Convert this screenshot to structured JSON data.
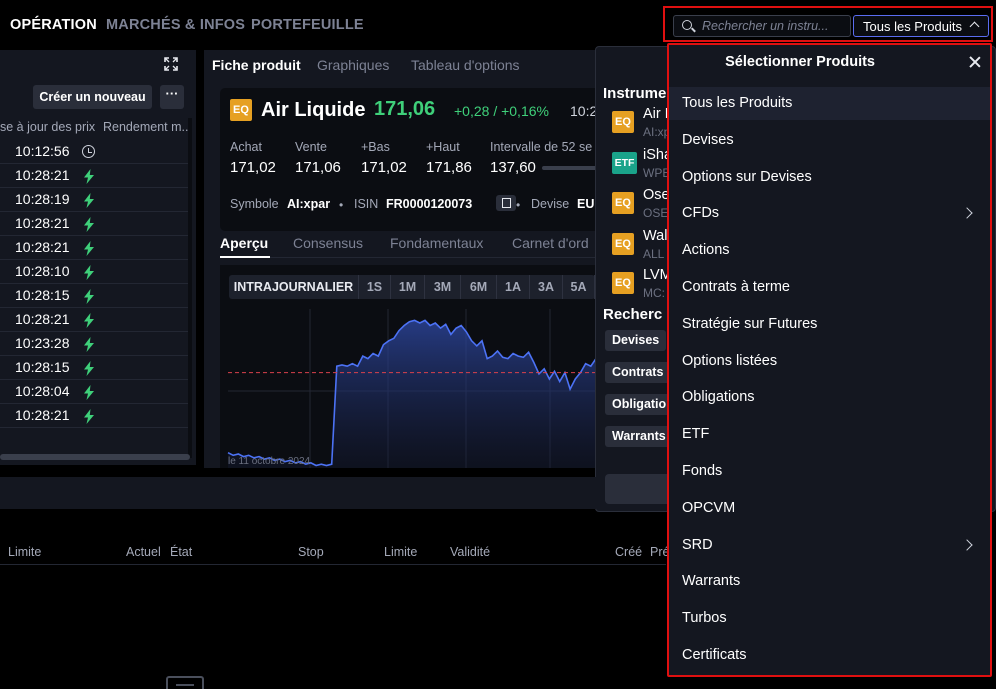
{
  "nav": {
    "items": [
      "OPÉRATION",
      "MARCHÉS & INFOS",
      "PORTEFEUILLE"
    ],
    "active_index": 0
  },
  "search": {
    "placeholder": "Rechercher un instru...",
    "product_filter": "Tous les Produits"
  },
  "left_panel": {
    "create_label": "Créer un nouveau",
    "more_label": "···",
    "col_price_update": "se à jour des prix",
    "col_yield": "Rendement m...",
    "rows": [
      {
        "time": "10:12:56",
        "icon": "clock-icon"
      },
      {
        "time": "10:28:21",
        "icon": "bolt-icon"
      },
      {
        "time": "10:28:19",
        "icon": "bolt-icon"
      },
      {
        "time": "10:28:21",
        "icon": "bolt-icon"
      },
      {
        "time": "10:28:21",
        "icon": "bolt-icon"
      },
      {
        "time": "10:28:10",
        "icon": "bolt-icon"
      },
      {
        "time": "10:28:15",
        "icon": "bolt-icon"
      },
      {
        "time": "10:28:21",
        "icon": "bolt-icon"
      },
      {
        "time": "10:23:28",
        "icon": "bolt-icon"
      },
      {
        "time": "10:28:15",
        "icon": "bolt-icon"
      },
      {
        "time": "10:28:04",
        "icon": "bolt-icon"
      },
      {
        "time": "10:28:21",
        "icon": "bolt-icon"
      }
    ]
  },
  "product": {
    "tabs": [
      "Fiche produit",
      "Graphiques",
      "Tableau d'options"
    ],
    "badge": "EQ",
    "name": "Air Liquide",
    "price": "171,06",
    "change": "+0,28 / +0,16%",
    "time": "10:2",
    "quotes": [
      {
        "label": "Achat",
        "value": "171,02"
      },
      {
        "label": "Vente",
        "value": "171,06"
      },
      {
        "label": "+Bas",
        "value": "171,02"
      },
      {
        "label": "+Haut",
        "value": "171,86"
      },
      {
        "label": "Intervalle de 52 se",
        "value": "137,60"
      }
    ],
    "symbol_label": "Symbole",
    "symbol": "AI:xpar",
    "isin_label": "ISIN",
    "isin": "FR0000120073",
    "devise_label": "Devise",
    "devise": "EU",
    "sub_tabs": [
      "Aperçu",
      "Consensus",
      "Fondamentaux",
      "Carnet d'ord"
    ],
    "periods": [
      "INTRAJOURNALIER",
      "1S",
      "1M",
      "3M",
      "6M",
      "1A",
      "3A",
      "5A"
    ],
    "date_label": "le   11 octobre 2024"
  },
  "chart_data": {
    "type": "area",
    "series": [
      {
        "values": [
          170.62,
          170.6,
          170.61,
          170.59,
          170.6,
          170.58,
          170.59,
          170.57,
          170.58,
          170.56,
          170.57,
          170.55,
          170.56,
          170.54,
          170.55,
          170.53,
          170.54,
          170.52,
          170.53,
          170.52,
          170.53,
          171.3,
          171.31,
          171.3,
          171.32,
          171.3,
          171.38,
          171.36,
          171.4,
          171.38,
          171.47,
          171.5,
          171.52,
          171.58,
          171.62,
          171.65,
          171.66,
          171.64,
          171.66,
          171.62,
          171.64,
          171.6,
          171.63,
          171.55,
          171.6,
          171.62,
          171.57,
          171.5,
          171.46,
          171.5,
          171.36,
          171.38,
          171.42,
          171.37,
          171.36,
          171.4,
          171.38,
          171.37,
          171.41,
          171.33,
          171.24,
          171.28,
          171.2,
          171.26,
          171.18,
          171.25,
          171.12,
          171.2,
          171.25,
          171.32,
          171.3,
          171.36
        ]
      }
    ],
    "reference_line": 171.25,
    "ylim": [
      170.5,
      171.75
    ]
  },
  "instruments": {
    "title": "Instrume",
    "items": [
      {
        "badge": "EQ",
        "name": "Air L",
        "sub": "AI:xp"
      },
      {
        "badge": "ETF",
        "name": "iSha",
        "sub": "WPE"
      },
      {
        "badge": "EQ",
        "name": "Ose",
        "sub": "OSE"
      },
      {
        "badge": "EQ",
        "name": "Wal",
        "sub": "ALL"
      },
      {
        "badge": "EQ",
        "name": "LVM",
        "sub": "MC:"
      }
    ],
    "search_title": "Recherc",
    "chips": [
      "Devises",
      "Contrats à",
      "Obligation",
      "Warrants"
    ]
  },
  "orders": {
    "headers": [
      {
        "label": "Limite",
        "name": "col-limite"
      },
      {
        "label": "Actuel",
        "name": "col-actuel"
      },
      {
        "label": "État",
        "name": "col-etat"
      },
      {
        "label": "Stop",
        "name": "col-stop"
      },
      {
        "label": "Limite",
        "name": "col-limite-2"
      },
      {
        "label": "Validité",
        "name": "col-validite"
      },
      {
        "label": "Créé",
        "name": "col-cree"
      },
      {
        "label": "Pré",
        "name": "col-pre"
      }
    ]
  },
  "dropdown": {
    "title": "Sélectionner Produits",
    "selected_index": 0,
    "items": [
      {
        "label": "Tous les Produits",
        "has_submenu": false
      },
      {
        "label": "Devises",
        "has_submenu": false
      },
      {
        "label": "Options sur Devises",
        "has_submenu": false
      },
      {
        "label": "CFDs",
        "has_submenu": true
      },
      {
        "label": "Actions",
        "has_submenu": false
      },
      {
        "label": "Contrats à terme",
        "has_submenu": false
      },
      {
        "label": "Stratégie sur Futures",
        "has_submenu": false
      },
      {
        "label": "Options listées",
        "has_submenu": false
      },
      {
        "label": "Obligations",
        "has_submenu": false
      },
      {
        "label": "ETF",
        "has_submenu": false
      },
      {
        "label": "Fonds",
        "has_submenu": false
      },
      {
        "label": "OPCVM",
        "has_submenu": false
      },
      {
        "label": "SRD",
        "has_submenu": true
      },
      {
        "label": "Warrants",
        "has_submenu": false
      },
      {
        "label": "Turbos",
        "has_submenu": false
      },
      {
        "label": "Certificats",
        "has_submenu": false
      }
    ]
  },
  "colors": {
    "accent": "#5a6cf0",
    "positive": "#3fd07a",
    "line": "#4c72f5",
    "highlight_outline": "#e01010",
    "eq_badge": "#e6a022",
    "etf_badge": "#1aa38a"
  }
}
